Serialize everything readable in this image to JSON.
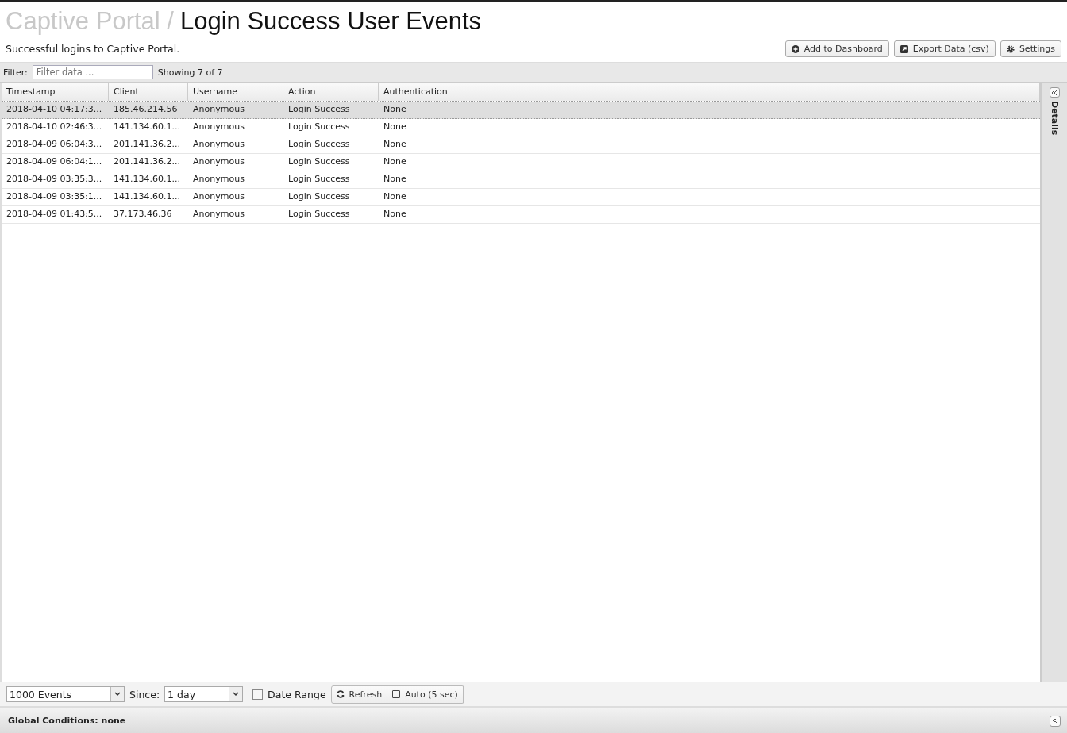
{
  "header": {
    "breadcrumb": "Captive Portal /",
    "title": "Login Success User Events",
    "description": "Successful logins to Captive Portal."
  },
  "actions": [
    {
      "kind": "add",
      "label": "Add to Dashboard"
    },
    {
      "kind": "export",
      "label": "Export Data (csv)"
    },
    {
      "kind": "settings",
      "label": "Settings"
    }
  ],
  "filter": {
    "label": "Filter:",
    "placeholder": "Filter data ...",
    "count": "Showing 7 of 7"
  },
  "table": {
    "columns": [
      "Timestamp",
      "Client",
      "Username",
      "Action",
      "Authentication"
    ],
    "rows": [
      {
        "selected": true,
        "cells": [
          "2018-04-10 04:17:3...",
          "185.46.214.56",
          "Anonymous",
          "Login Success",
          "None"
        ]
      },
      {
        "selected": false,
        "cells": [
          "2018-04-10 02:46:3...",
          "141.134.60.1...",
          "Anonymous",
          "Login Success",
          "None"
        ]
      },
      {
        "selected": false,
        "cells": [
          "2018-04-09 06:04:3...",
          "201.141.36.2...",
          "Anonymous",
          "Login Success",
          "None"
        ]
      },
      {
        "selected": false,
        "cells": [
          "2018-04-09 06:04:1...",
          "201.141.36.2...",
          "Anonymous",
          "Login Success",
          "None"
        ]
      },
      {
        "selected": false,
        "cells": [
          "2018-04-09 03:35:3...",
          "141.134.60.1...",
          "Anonymous",
          "Login Success",
          "None"
        ]
      },
      {
        "selected": false,
        "cells": [
          "2018-04-09 03:35:1...",
          "141.134.60.1...",
          "Anonymous",
          "Login Success",
          "None"
        ]
      },
      {
        "selected": false,
        "cells": [
          "2018-04-09 01:43:5...",
          "37.173.46.36",
          "Anonymous",
          "Login Success",
          "None"
        ]
      }
    ]
  },
  "details_panel": {
    "label": "Details"
  },
  "toolbar": {
    "limit": "1000 Events",
    "since_label": "Since:",
    "since": "1 day",
    "date_range": {
      "label": "Date Range",
      "checked": false
    },
    "refresh": "Refresh",
    "auto": {
      "label": "Auto (5 sec)",
      "checked": false
    }
  },
  "global_conditions": "Global Conditions: none"
}
